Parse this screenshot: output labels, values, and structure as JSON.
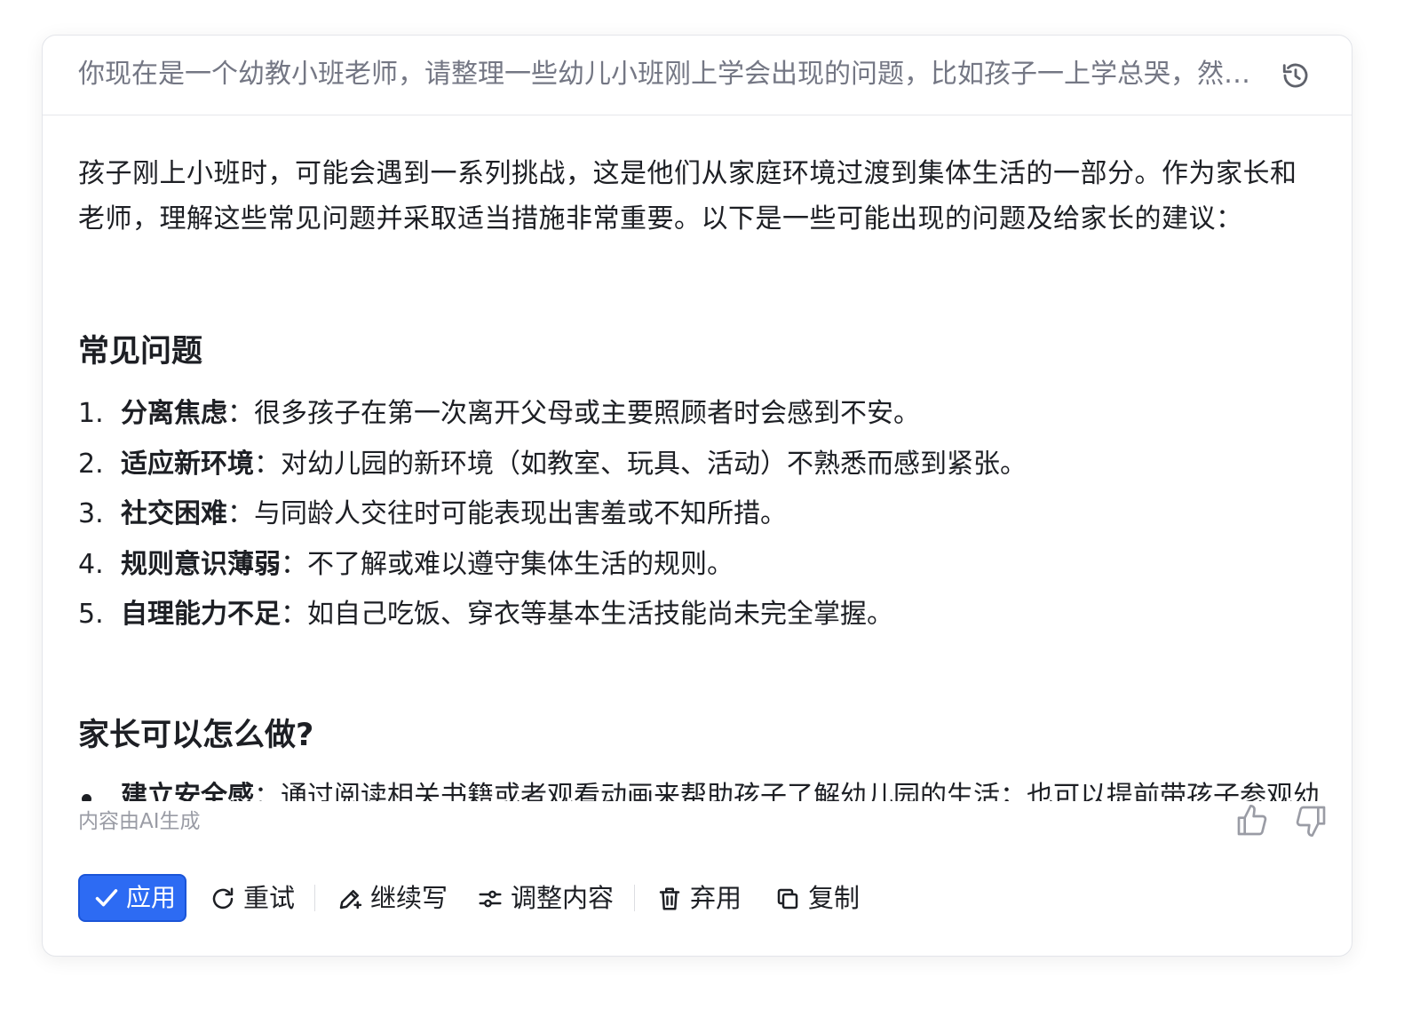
{
  "prompt": {
    "text": "你现在是一个幼教小班老师，请整理一些幼儿小班刚上学会出现的问题，比如孩子一上学总哭，然后给家长一些建议"
  },
  "icons": {
    "history": "history-icon",
    "thumbs_up": "thumbs-up-icon",
    "thumbs_down": "thumbs-down-icon",
    "check": "check-icon",
    "retry": "refresh-icon",
    "continue": "pen-sparkle-icon",
    "adjust": "sliders-icon",
    "discard": "trash-icon",
    "copy": "copy-icon"
  },
  "response": {
    "intro": "孩子刚上小班时，可能会遇到一系列挑战，这是他们从家庭环境过渡到集体生活的一部分。作为家长和老师，理解这些常见问题并采取适当措施非常重要。以下是一些可能出现的问题及给家长的建议：",
    "section1_title": "常见问题",
    "problems": [
      {
        "num": "1.",
        "term": "分离焦虑",
        "desc": "：很多孩子在第一次离开父母或主要照顾者时会感到不安。"
      },
      {
        "num": "2.",
        "term": "适应新环境",
        "desc": "：对幼儿园的新环境（如教室、玩具、活动）不熟悉而感到紧张。"
      },
      {
        "num": "3.",
        "term": "社交困难",
        "desc": "：与同龄人交往时可能表现出害羞或不知所措。"
      },
      {
        "num": "4.",
        "term": "规则意识薄弱",
        "desc": "：不了解或难以遵守集体生活的规则。"
      },
      {
        "num": "5.",
        "term": "自理能力不足",
        "desc": "：如自己吃饭、穿衣等基本生活技能尚未完全掌握。"
      }
    ],
    "section2_title": "家长可以怎么做?",
    "tips": [
      {
        "term": "建立安全感",
        "desc": "：通过阅读相关书籍或者观看动画来帮助孩子了解幼儿园的生活；也可以提前带孩子参观幼儿园，让他/她对即将进入的新环境有所期待。"
      }
    ]
  },
  "footer": {
    "ai_note": "内容由AI生成"
  },
  "toolbar": {
    "apply": "应用",
    "retry": "重试",
    "continue": "继续写",
    "adjust": "调整内容",
    "discard": "弃用",
    "copy": "复制"
  },
  "colors": {
    "primary": "#2d6bf3",
    "text": "#1d1f24",
    "muted": "#9a9ca5"
  }
}
